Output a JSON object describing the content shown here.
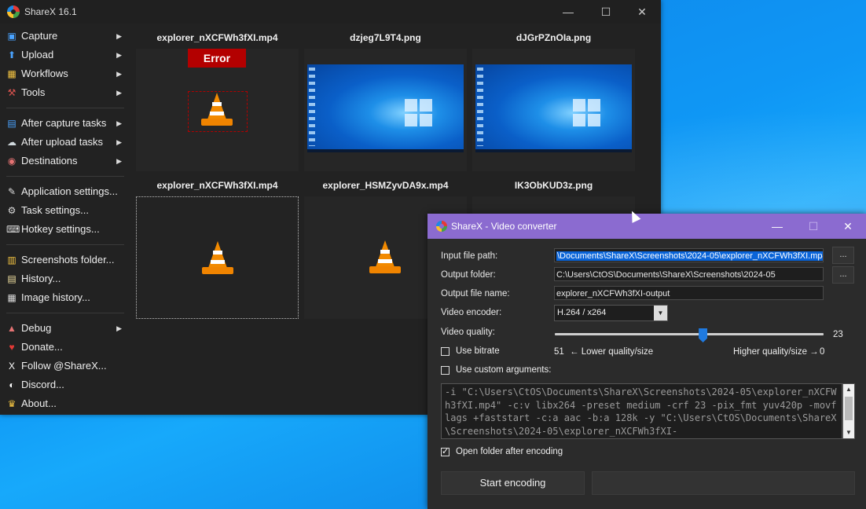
{
  "main_window": {
    "title": "ShareX 16.1",
    "controls": {
      "minimize": "—",
      "maximize": "☐",
      "close": "✕"
    }
  },
  "menu": {
    "items": [
      {
        "label": "Capture",
        "icon": "capture-icon",
        "has_submenu": true
      },
      {
        "label": "Upload",
        "icon": "upload-icon",
        "has_submenu": true
      },
      {
        "label": "Workflows",
        "icon": "workflows-icon",
        "has_submenu": true
      },
      {
        "label": "Tools",
        "icon": "tools-icon",
        "has_submenu": true
      },
      {
        "label": "After capture tasks",
        "icon": "after-capture-icon",
        "has_submenu": true
      },
      {
        "label": "After upload tasks",
        "icon": "after-upload-icon",
        "has_submenu": true
      },
      {
        "label": "Destinations",
        "icon": "destinations-icon",
        "has_submenu": true
      },
      {
        "label": "Application settings...",
        "icon": "app-settings-icon",
        "has_submenu": false
      },
      {
        "label": "Task settings...",
        "icon": "task-settings-icon",
        "has_submenu": false
      },
      {
        "label": "Hotkey settings...",
        "icon": "hotkey-settings-icon",
        "has_submenu": false
      },
      {
        "label": "Screenshots folder...",
        "icon": "screenshots-folder-icon",
        "has_submenu": false
      },
      {
        "label": "History...",
        "icon": "history-icon",
        "has_submenu": false
      },
      {
        "label": "Image history...",
        "icon": "image-history-icon",
        "has_submenu": false
      },
      {
        "label": "Debug",
        "icon": "debug-icon",
        "has_submenu": true
      },
      {
        "label": "Donate...",
        "icon": "donate-icon",
        "has_submenu": false
      },
      {
        "label": "Follow @ShareX...",
        "icon": "x-logo-icon",
        "has_submenu": false
      },
      {
        "label": "Discord...",
        "icon": "discord-icon",
        "has_submenu": false
      },
      {
        "label": "About...",
        "icon": "about-icon",
        "has_submenu": false
      }
    ],
    "submenu_arrow": "▶"
  },
  "thumbnails": [
    {
      "title": "explorer_nXCFWh3fXI.mp4",
      "kind": "video",
      "error": "Error"
    },
    {
      "title": "dzjeg7L9T4.png",
      "kind": "image"
    },
    {
      "title": "dJGrPZnOIa.png",
      "kind": "image"
    },
    {
      "title": "explorer_nXCFWh3fXI.mp4",
      "kind": "video",
      "selected": true
    },
    {
      "title": "explorer_HSMZyvDA9x.mp4",
      "kind": "video"
    },
    {
      "title": "IK3ObKUD3z.png",
      "kind": "image"
    }
  ],
  "video_converter": {
    "title": "ShareX - Video converter",
    "controls": {
      "minimize": "—",
      "maximize": "☐",
      "close": "✕"
    },
    "labels": {
      "input_path": "Input file path:",
      "output_folder": "Output folder:",
      "output_name": "Output file name:",
      "encoder": "Video encoder:",
      "quality": "Video quality:"
    },
    "input_path_value": "\\Documents\\ShareX\\Screenshots\\2024-05\\explorer_nXCFWh3fXI.mp4",
    "output_folder_value": "C:\\Users\\CtOS\\Documents\\ShareX\\Screenshots\\2024-05",
    "output_name_value": "explorer_nXCFWh3fXI-output",
    "browse_label": "...",
    "encoder_value": "H.264 / x264",
    "dropdown_arrow": "▼",
    "quality_value": "23",
    "quality_fraction": 0.55,
    "use_bitrate_label": "Use bitrate",
    "use_bitrate_checked": false,
    "bitrate_left": "51",
    "bitrate_lower": "← Lower quality/size",
    "bitrate_higher": "Higher quality/size →",
    "bitrate_right": "0",
    "custom_args_label": "Use custom arguments:",
    "custom_args_checked": false,
    "arguments_text": "-i \"C:\\Users\\CtOS\\Documents\\ShareX\\Screenshots\\2024-05\\explorer_nXCFWh3fXI.mp4\" -c:v libx264 -preset medium -crf 23 -pix_fmt yuv420p -movflags +faststart -c:a aac -b:a 128k -y \"C:\\Users\\CtOS\\Documents\\ShareX\\Screenshots\\2024-05\\explorer_nXCFWh3fXI-",
    "open_folder_label": "Open folder after encoding",
    "open_folder_checked": true,
    "start_label": "Start encoding",
    "scroll_up": "▲",
    "scroll_down": "▼"
  },
  "colors": {
    "titlebar_accent": "#8b6bd0",
    "error": "#b30000",
    "selection": "#0a64d8",
    "slider": "#1f7ae0"
  }
}
